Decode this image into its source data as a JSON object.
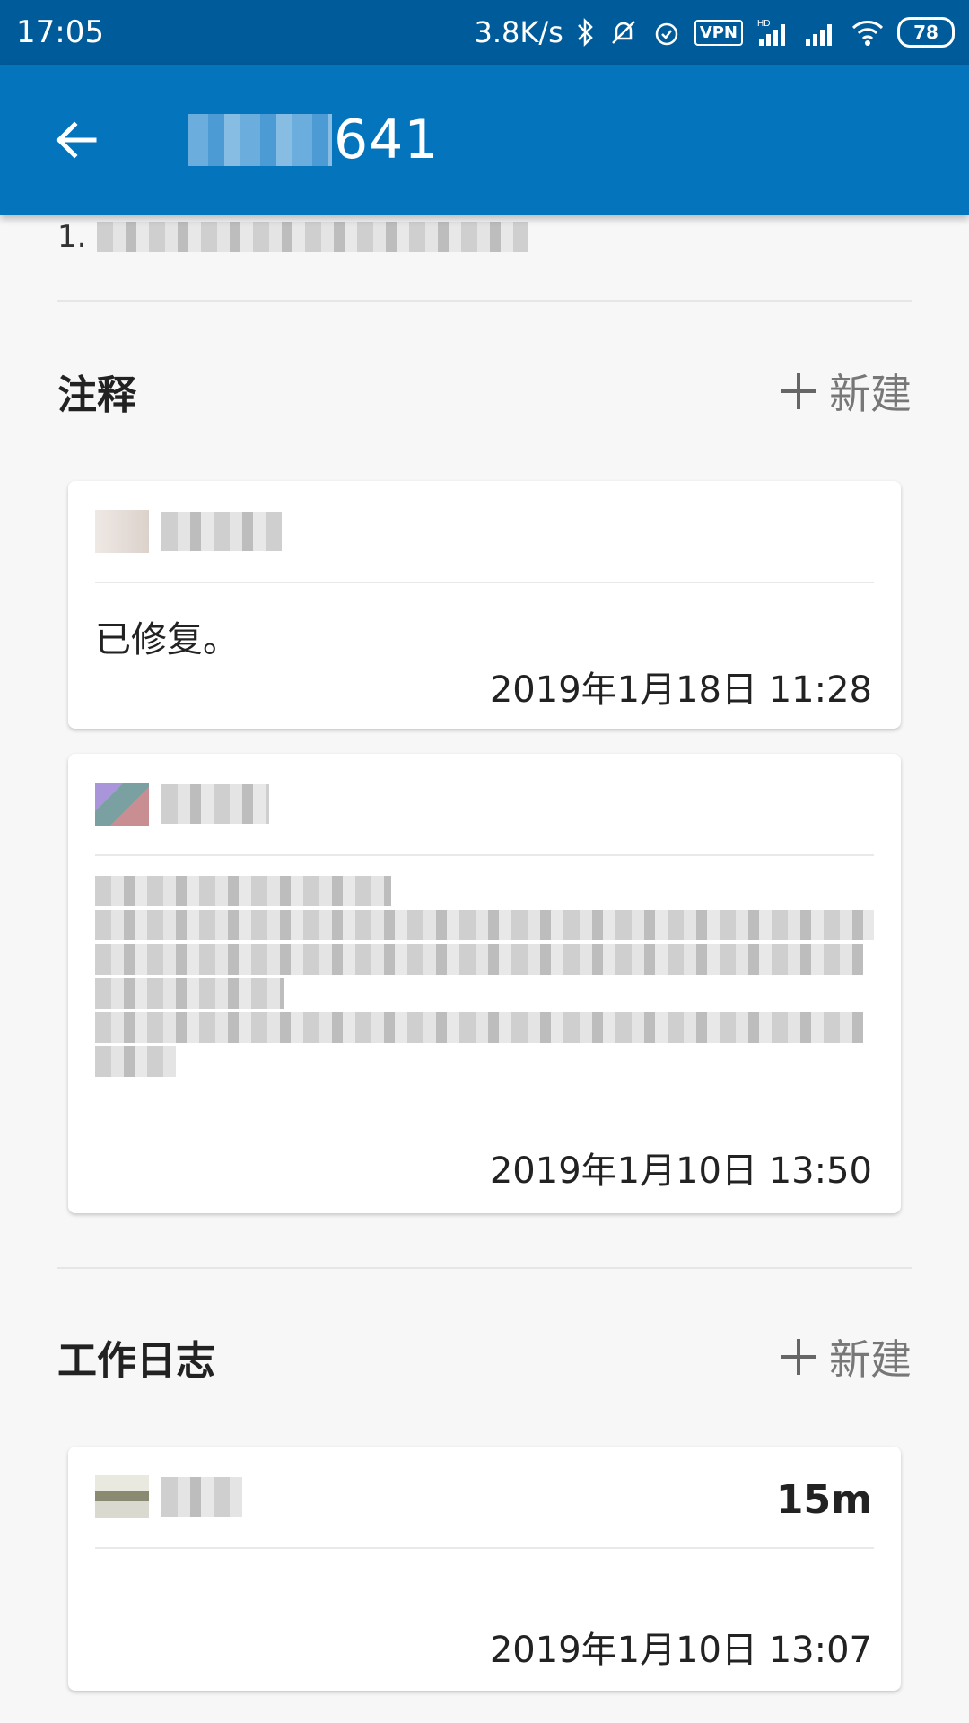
{
  "status_bar": {
    "time": "17:05",
    "net_speed": "3.8K/s",
    "vpn": "VPN",
    "hd": "HD",
    "battery": "78"
  },
  "app_bar": {
    "title_suffix": "641",
    "back_icon": "arrow-left-icon"
  },
  "top_list": {
    "number": "1."
  },
  "comments_section": {
    "title": "注释",
    "new_label": "新建",
    "cards": [
      {
        "text": "已修复。",
        "date": "2019年1月18日  11:28"
      },
      {
        "text": "",
        "date": "2019年1月10日  13:50"
      }
    ]
  },
  "worklog_section": {
    "title": "工作日志",
    "new_label": "新建",
    "cards": [
      {
        "duration": "15m",
        "date": "2019年1月10日  13:07"
      }
    ]
  },
  "colors": {
    "status_bar": "#005b9a",
    "app_bar": "#0474bd",
    "background": "#f7f7f7"
  }
}
